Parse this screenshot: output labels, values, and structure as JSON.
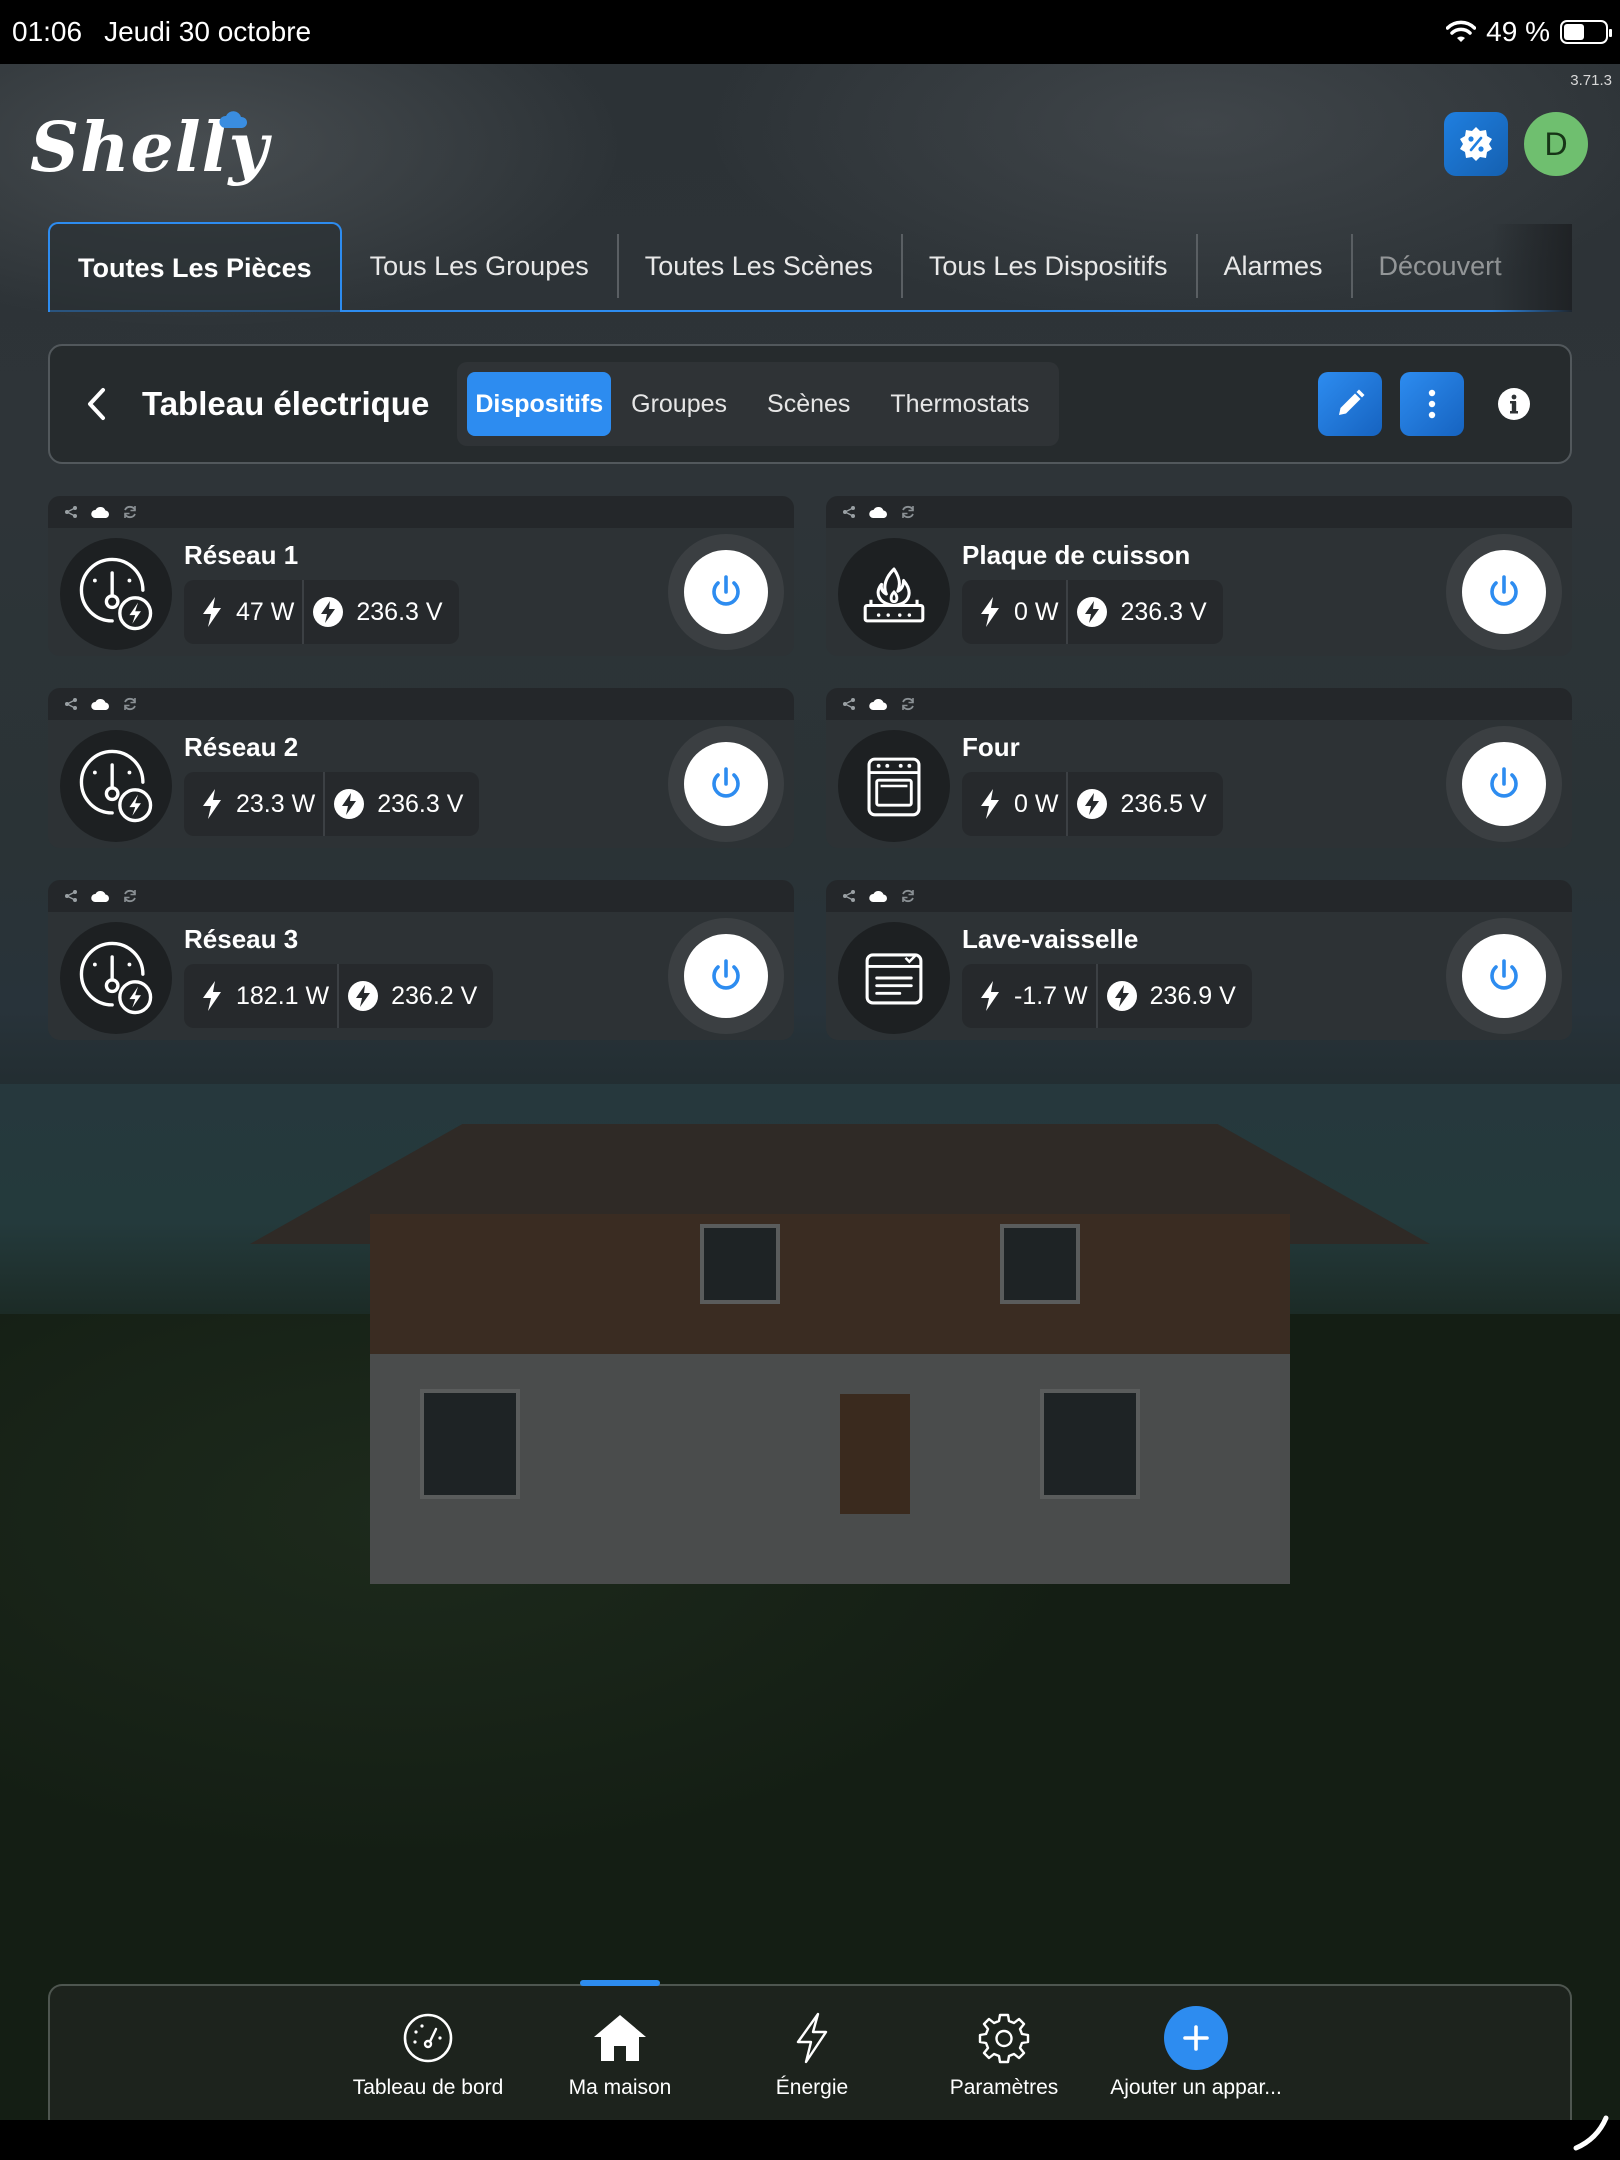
{
  "status_bar": {
    "time": "01:06",
    "date": "Jeudi 30 octobre",
    "battery": "49 %",
    "battery_level": 0.49
  },
  "app": {
    "version": "3.71.3",
    "logo_text": "Shelly",
    "avatar_initial": "D",
    "accent_color": "#2d8cf0"
  },
  "main_tabs": [
    {
      "label": "Toutes Les Pièces",
      "active": true
    },
    {
      "label": "Tous Les Groupes",
      "active": false
    },
    {
      "label": "Toutes Les Scènes",
      "active": false
    },
    {
      "label": "Tous Les Dispositifs",
      "active": false
    },
    {
      "label": "Alarmes",
      "active": false
    },
    {
      "label": "Découvert",
      "active": false
    }
  ],
  "room": {
    "title": "Tableau électrique",
    "segments": [
      {
        "label": "Dispositifs",
        "active": true
      },
      {
        "label": "Groupes",
        "active": false
      },
      {
        "label": "Scènes",
        "active": false
      },
      {
        "label": "Thermostats",
        "active": false
      }
    ]
  },
  "devices": [
    {
      "name": "Réseau 1",
      "power": "47 W",
      "voltage": "236.3 V",
      "icon": "meter-icon"
    },
    {
      "name": "Plaque de cuisson",
      "power": "0 W",
      "voltage": "236.3 V",
      "icon": "cooktop-icon"
    },
    {
      "name": "Réseau 2",
      "power": "23.3 W",
      "voltage": "236.3 V",
      "icon": "meter-icon"
    },
    {
      "name": "Four",
      "power": "0 W",
      "voltage": "236.5 V",
      "icon": "oven-icon"
    },
    {
      "name": "Réseau 3",
      "power": "182.1 W",
      "voltage": "236.2 V",
      "icon": "meter-icon"
    },
    {
      "name": "Lave-vaisselle",
      "power": "-1.7 W",
      "voltage": "236.9 V",
      "icon": "dishwasher-icon"
    }
  ],
  "bottom_nav": [
    {
      "label": "Tableau de bord",
      "icon": "gauge-icon",
      "active": false
    },
    {
      "label": "Ma maison",
      "icon": "home-icon",
      "active": true
    },
    {
      "label": "Énergie",
      "icon": "lightning-icon",
      "active": false
    },
    {
      "label": "Paramètres",
      "icon": "gear-icon",
      "active": false
    },
    {
      "label": "Ajouter un appar...",
      "icon": "plus-icon",
      "active": false
    }
  ]
}
